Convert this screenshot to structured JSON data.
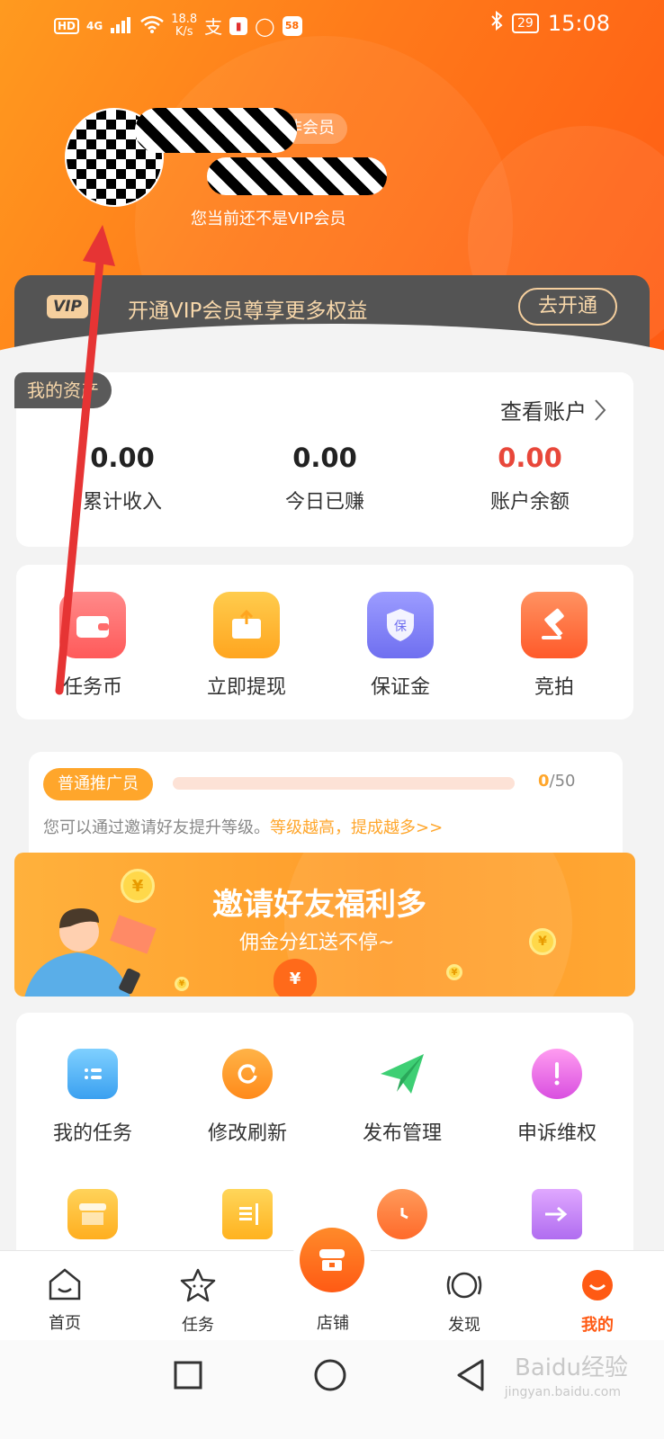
{
  "status_bar": {
    "left_icons": [
      "HD",
      "4G",
      "signal-icon",
      "wifi-icon"
    ],
    "hd": "HD",
    "net": "4G",
    "speed_top": "18.8",
    "speed_bottom": "K/s",
    "app58": "58",
    "battery": "29",
    "time": "15:08"
  },
  "profile": {
    "member_label": "非会员",
    "vip_status_text": "您当前还不是VIP会员"
  },
  "vip_strip": {
    "badge": "VIP",
    "text": "开通VIP会员尊享更多权益",
    "button": "去开通"
  },
  "assets": {
    "tag": "我的资产",
    "view_account": "查看账户",
    "stats": [
      {
        "value": "0.00",
        "label": "累计收入",
        "color": "#222222"
      },
      {
        "value": "0.00",
        "label": "今日已赚",
        "color": "#222222"
      },
      {
        "value": "0.00",
        "label": "账户余额",
        "color": "#e8473a"
      }
    ]
  },
  "actions": [
    {
      "label": "任务币",
      "icon": "wallet-icon",
      "color": "#ff6b6b"
    },
    {
      "label": "立即提现",
      "icon": "withdraw-icon",
      "color": "#ffb13a"
    },
    {
      "label": "保证金",
      "icon": "shield-icon",
      "color": "#7b7bf2"
    },
    {
      "label": "竞拍",
      "icon": "gavel-icon",
      "color": "#ff7043"
    }
  ],
  "promoter": {
    "tag": "普通推广员",
    "progress_current": "0",
    "progress_total": "/50",
    "desc": "您可以通过邀请好友提升等级。",
    "desc_highlight": "等级越高，提成越多>>"
  },
  "banner": {
    "title": "邀请好友福利多",
    "subtitle": "佣金分红送不停~"
  },
  "services": [
    {
      "label": "我的任务",
      "icon": "task-list-icon",
      "color": "#4fb3f5"
    },
    {
      "label": "修改刷新",
      "icon": "refresh-icon",
      "color": "#ff9f2a"
    },
    {
      "label": "发布管理",
      "icon": "paper-plane-icon",
      "color": "#37c26b"
    },
    {
      "label": "申诉维权",
      "icon": "alert-icon",
      "color": "#e65fe0"
    },
    {
      "icon": "shop-icon",
      "color": "#ffb72a"
    },
    {
      "icon": "notebook-icon",
      "color": "#ffc02a"
    },
    {
      "icon": "alarm-clock-icon",
      "color": "#ff7a3a"
    },
    {
      "icon": "forward-icon",
      "color": "#c27af5"
    }
  ],
  "nav": {
    "home": "首页",
    "tasks": "任务",
    "shop": "店铺",
    "discover": "发现",
    "mine": "我的",
    "active_color": "#ff5a14"
  },
  "watermark": {
    "main": "Baidu经验",
    "url": "jingyan.baidu.com"
  }
}
